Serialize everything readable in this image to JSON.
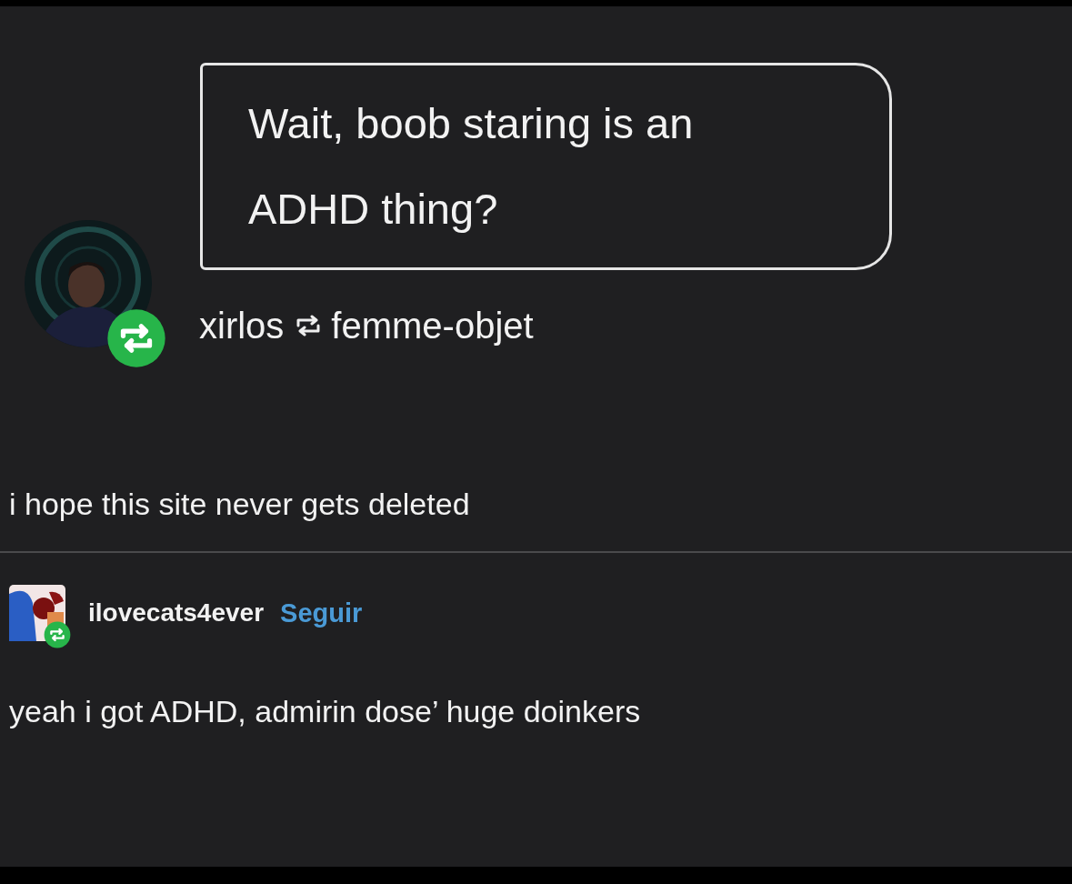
{
  "post": {
    "quote": "Wait, boob staring is an ADHD thing?",
    "author": "xirlos",
    "reblogged_from": "femme-objet",
    "reblogged": true
  },
  "caption": "i hope this site never gets deleted",
  "reply": {
    "author": "ilovecats4ever",
    "follow_label": "Seguir",
    "reblogged": true,
    "text": "yeah i got ADHD, admirin dose’ huge doinkers"
  }
}
